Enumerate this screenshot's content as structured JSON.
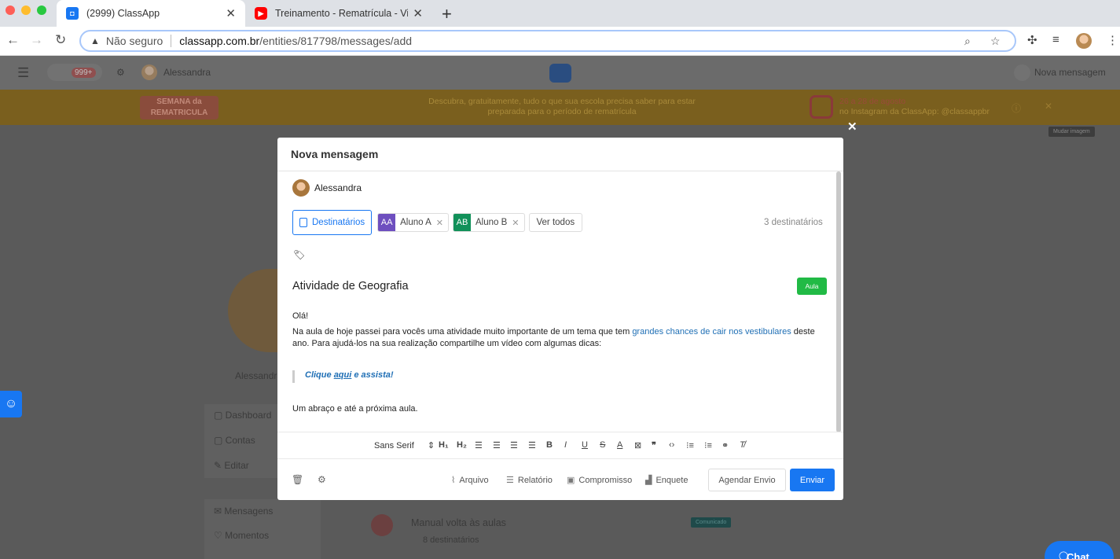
{
  "browser": {
    "tabs": [
      {
        "title": "(2999) ClassApp",
        "active": true
      },
      {
        "title": "Treinamento - Rematrícula - Vi",
        "active": false
      }
    ],
    "url_security": "Não seguro",
    "url_host": "classapp.com.br",
    "url_path": "/entities/817798/messages/add",
    "colors": {
      "accent": "#1877f2",
      "tab_bar": "#dee1e6"
    }
  },
  "app": {
    "header": {
      "badge": "999+",
      "user": "Alessandra",
      "right_label": "Nova mensagem"
    },
    "banner": {
      "logo_line1": "SEMANA da",
      "logo_line2": "REMATRICULA",
      "text": "Descubra, gratuitamente, tudo o que sua escola precisa saber para estar preparada para o período de rematrícula",
      "date": "26 a 28 de agosto",
      "insta": "no Instagram da ClassApp: @classappbr"
    },
    "change_image": "Mudar imagem",
    "profile_name": "Alessandra",
    "menu": [
      "Dashboard",
      "Contas",
      "Editar",
      "Mensagens",
      "Momentos"
    ],
    "list_item": {
      "title": "Manual volta às aulas",
      "sub": "8 destinatários",
      "tag": "Comunicado"
    },
    "chat": "Chat"
  },
  "modal": {
    "title": "Nova mensagem",
    "sender": "Alessandra",
    "recipients_button": "Destinatários",
    "recipients": [
      {
        "initials": "AA",
        "name": "Aluno A",
        "color": "#6e4fbf"
      },
      {
        "initials": "AB",
        "name": "Aluno B",
        "color": "#12915a"
      }
    ],
    "see_all": "Ver todos",
    "recipient_count": "3 destinatários",
    "subject": "Atividade de Geografia",
    "badge": "Aula",
    "greeting": "Olá!",
    "p1_start": "Na aula de hoje passei para vocês uma atividade muito importante de um tema que tem",
    "p1_link": "grandes chances de cair nos vestibulares",
    "p1_end": "deste ano. Para ajudá-los na sua realização compartilhe um vídeo com algumas dicas:",
    "quote_a": "Clique",
    "quote_link": "aqui",
    "quote_b": "e assista!",
    "closing": "Um abraço e até a próxima aula.",
    "font": "Sans Serif",
    "footer": {
      "file": "Arquivo",
      "report": "Relatório",
      "commitment": "Compromisso",
      "poll": "Enquete",
      "schedule": "Agendar Envio",
      "send": "Enviar"
    }
  }
}
